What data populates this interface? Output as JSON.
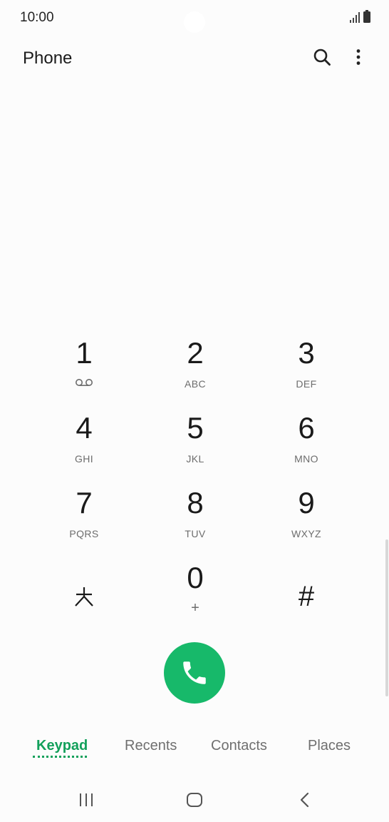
{
  "status_bar": {
    "time": "10:00",
    "signal_icon": "signal-icon",
    "battery_icon": "battery-icon"
  },
  "app_bar": {
    "title": "Phone",
    "search_icon": "search-icon",
    "more_icon": "more-vert-icon"
  },
  "keypad": {
    "keys": [
      {
        "digit": "1",
        "letters": "",
        "sub_icon": "voicemail-icon"
      },
      {
        "digit": "2",
        "letters": "ABC"
      },
      {
        "digit": "3",
        "letters": "DEF"
      },
      {
        "digit": "4",
        "letters": "GHI"
      },
      {
        "digit": "5",
        "letters": "JKL"
      },
      {
        "digit": "6",
        "letters": "MNO"
      },
      {
        "digit": "7",
        "letters": "PQRS"
      },
      {
        "digit": "8",
        "letters": "TUV"
      },
      {
        "digit": "9",
        "letters": "WXYZ"
      },
      {
        "digit": "⁎",
        "letters": ""
      },
      {
        "digit": "0",
        "letters": "+"
      },
      {
        "digit": "#",
        "letters": ""
      }
    ]
  },
  "call_button": {
    "icon": "phone-icon",
    "color": "#17b96a"
  },
  "tabs": [
    {
      "label": "Keypad",
      "active": true
    },
    {
      "label": "Recents",
      "active": false
    },
    {
      "label": "Contacts",
      "active": false
    },
    {
      "label": "Places",
      "active": false
    }
  ],
  "accent_color": "#12a05b",
  "nav_bar": {
    "recents_icon": "recent-apps-icon",
    "home_icon": "home-icon",
    "back_icon": "back-icon"
  }
}
